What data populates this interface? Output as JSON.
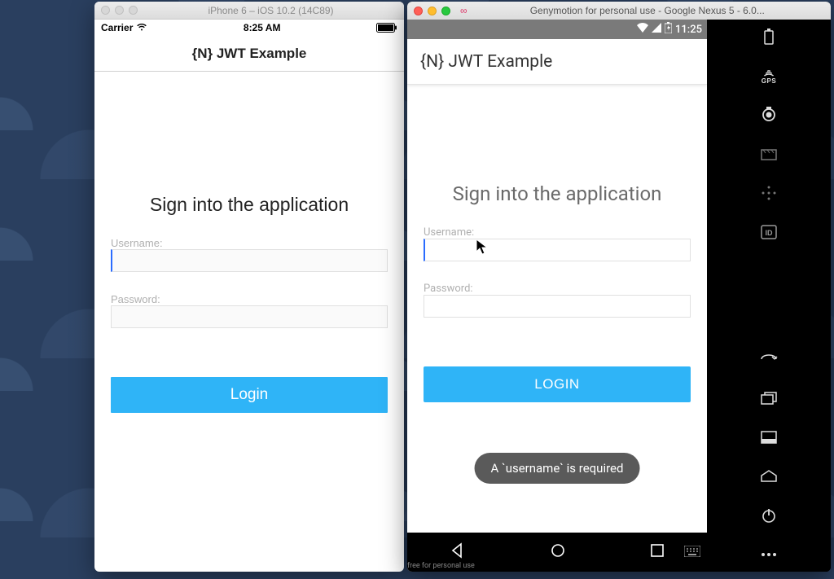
{
  "ios": {
    "windowTitle": "iPhone 6 – iOS 10.2 (14C89)",
    "carrier": "Carrier",
    "time": "8:25 AM",
    "appTitle": "{N} JWT Example",
    "heading": "Sign into the application",
    "usernameLabel": "Username:",
    "passwordLabel": "Password:",
    "loginButton": "Login"
  },
  "android": {
    "windowTitle": "Genymotion for personal use - Google Nexus 5 - 6.0...",
    "time": "11:25",
    "appTitle": "{N} JWT Example",
    "heading": "Sign into the application",
    "usernameLabel": "Username:",
    "passwordLabel": "Password:",
    "loginButton": "LOGIN",
    "toast": "A `username` is required",
    "freeTag": "free for personal use",
    "gpsLabel": "GPS",
    "idLabel": "ID"
  },
  "colors": {
    "accentButton": "#2fb4f7",
    "toastBg": "#5a5a5a"
  }
}
